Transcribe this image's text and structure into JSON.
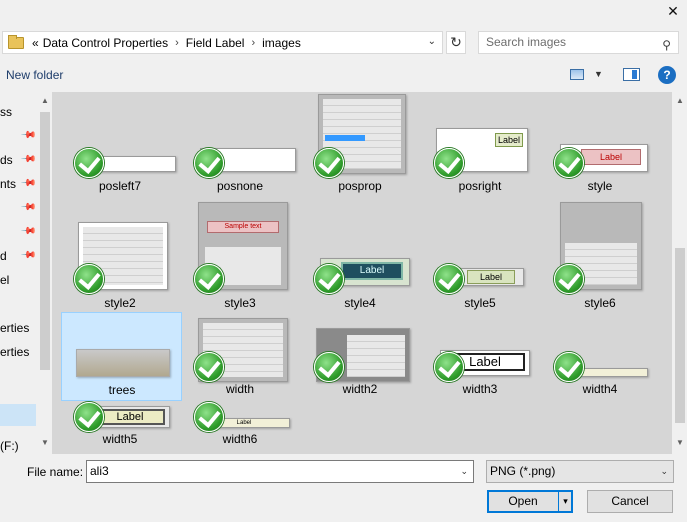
{
  "window": {
    "close_glyph": "✕"
  },
  "breadcrumb": {
    "prefix": "«",
    "items": [
      "Data Control Properties",
      "Field Label",
      "images"
    ]
  },
  "search": {
    "placeholder": "Search images"
  },
  "toolbar": {
    "new_folder": "New folder"
  },
  "nav": {
    "items": [
      "ss",
      "ds",
      "nts",
      "d",
      "el",
      "erties",
      "erties",
      "(F:)"
    ]
  },
  "files": [
    {
      "name": "posleft7"
    },
    {
      "name": "posnone"
    },
    {
      "name": "posprop"
    },
    {
      "name": "posright",
      "thumb_text": "Label"
    },
    {
      "name": "style",
      "thumb_text": "Label"
    },
    {
      "name": "style2"
    },
    {
      "name": "style3",
      "thumb_text": "Sample text"
    },
    {
      "name": "style4",
      "thumb_text": "Label"
    },
    {
      "name": "style5",
      "thumb_text": "Label"
    },
    {
      "name": "style6"
    },
    {
      "name": "trees"
    },
    {
      "name": "width"
    },
    {
      "name": "width2"
    },
    {
      "name": "width3",
      "thumb_text": "Label"
    },
    {
      "name": "width4"
    },
    {
      "name": "width5",
      "thumb_text": "Label"
    },
    {
      "name": "width6",
      "thumb_text": "Label"
    }
  ],
  "footer": {
    "file_name_label": "File name:",
    "file_name_value": "ali3",
    "file_type": "PNG (*.png)",
    "open_label": "Open",
    "cancel_label": "Cancel"
  },
  "colors": {
    "selection": "#cce8ff",
    "accent": "#0078d7",
    "check": "#2e9b2a"
  }
}
